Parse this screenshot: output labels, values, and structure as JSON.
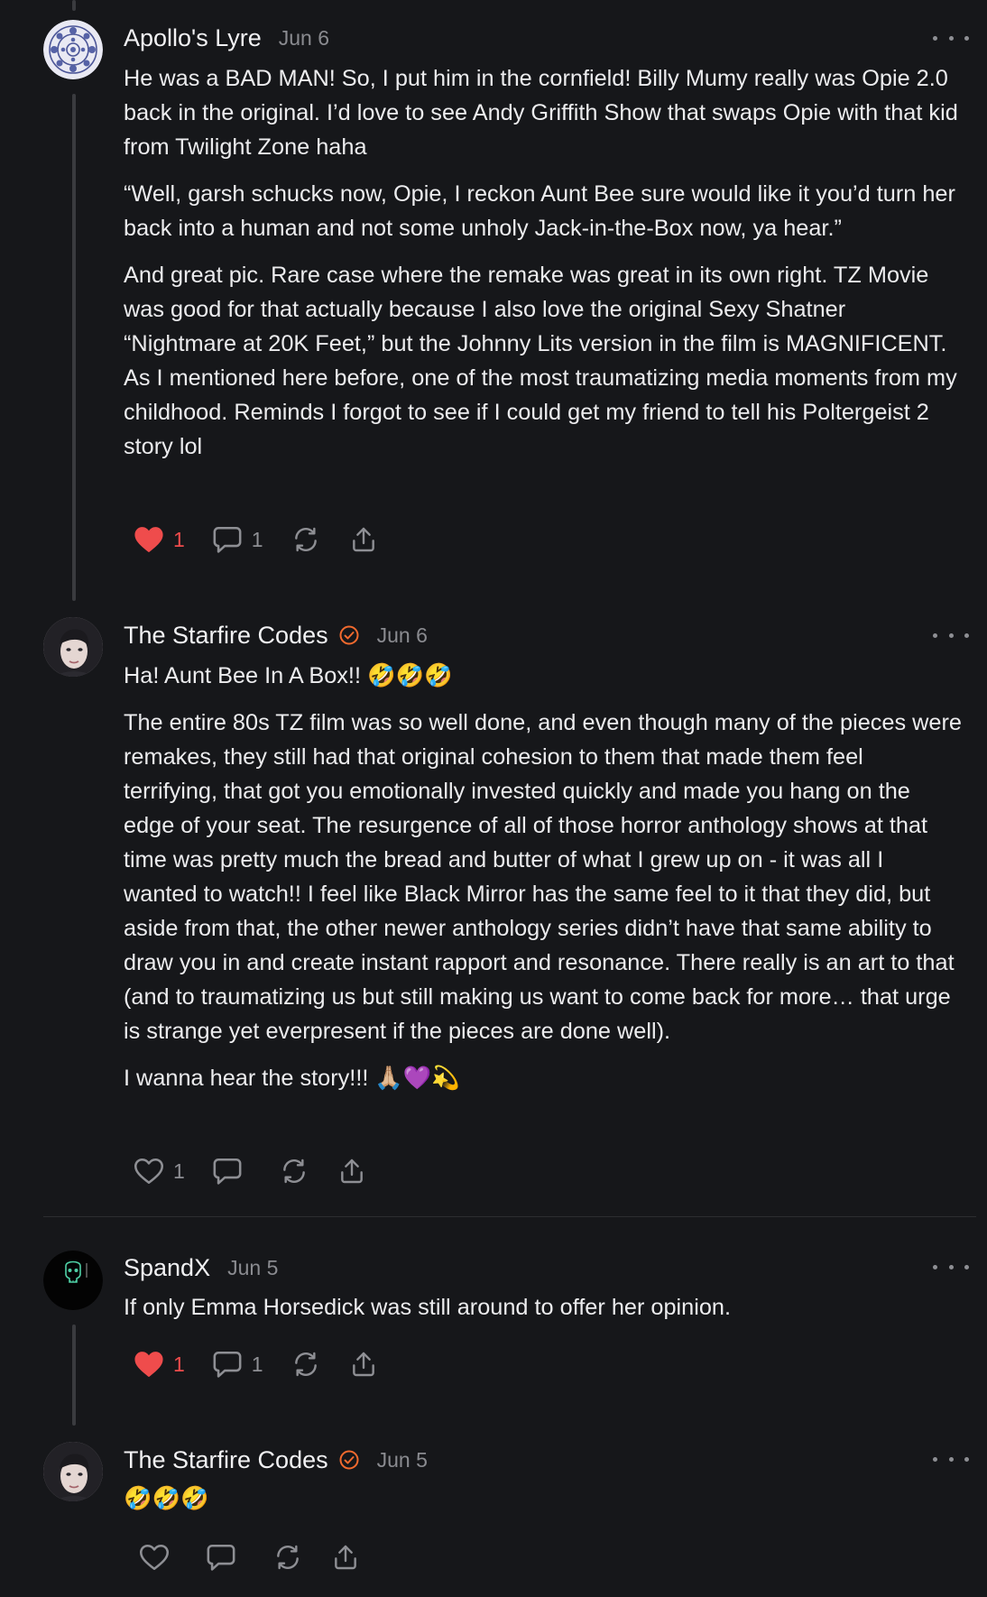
{
  "comments": [
    {
      "author": "Apollo's Lyre",
      "date": "Jun 6",
      "verified": false,
      "paragraphs": [
        "He was a BAD MAN! So, I put him in the cornfield! Billy Mumy really was Opie 2.0 back in the original. I’d love to see Andy Griffith Show that swaps Opie with that kid from Twilight Zone haha",
        "“Well, garsh schucks now, Opie, I reckon Aunt Bee sure would like it you’d turn her back into a human and not some unholy Jack-in-the-Box now, ya hear.”",
        "And great pic. Rare case where the remake was great in its own right. TZ Movie was good for that actually because I also love the original Sexy Shatner “Nightmare at 20K Feet,” but the Johnny Lits version in the film is MAGNIFICENT. As I mentioned here before, one of the most traumatizing media moments from my childhood. Reminds I forgot to see if I could get my friend to tell his Poltergeist 2 story lol"
      ],
      "likes": "1",
      "liked": true,
      "replies": "1"
    },
    {
      "author": "The Starfire Codes",
      "date": "Jun 6",
      "verified": true,
      "paragraphs": [
        "Ha! Aunt Bee In A Box!! 🤣🤣🤣",
        "The entire 80s TZ film was so well done, and even though many of the pieces were remakes, they still had that original cohesion to them that made them feel terrifying, that got you emotionally invested quickly and made you hang on the edge of your seat. The resurgence of all of those horror anthology shows at that time was pretty much the bread and butter of what I grew up on - it was all I wanted to watch!! I feel like Black Mirror has the same feel to it that they did, but aside from that, the other newer anthology series didn’t have that same ability to draw you in and create instant rapport and resonance. There really is an art to that (and to traumatizing us but still making us want to come back for more… that urge is strange yet everpresent if the pieces are done well).",
        "I wanna hear the story!!! 🙏🏼💜💫"
      ],
      "likes": "1",
      "liked": false,
      "replies": ""
    },
    {
      "author": "SpandX",
      "date": "Jun 5",
      "verified": false,
      "paragraphs": [
        "If only Emma Horsedick was still around to offer her opinion."
      ],
      "likes": "1",
      "liked": true,
      "replies": "1"
    },
    {
      "author": "The Starfire Codes",
      "date": "Jun 5",
      "verified": true,
      "paragraphs": [
        "🤣🤣🤣"
      ],
      "likes": "",
      "liked": false,
      "replies": ""
    }
  ],
  "colors": {
    "background": "#16171a",
    "like_active": "#ef4c4c",
    "verified": "#f26a2e",
    "muted": "#8e8f94"
  }
}
